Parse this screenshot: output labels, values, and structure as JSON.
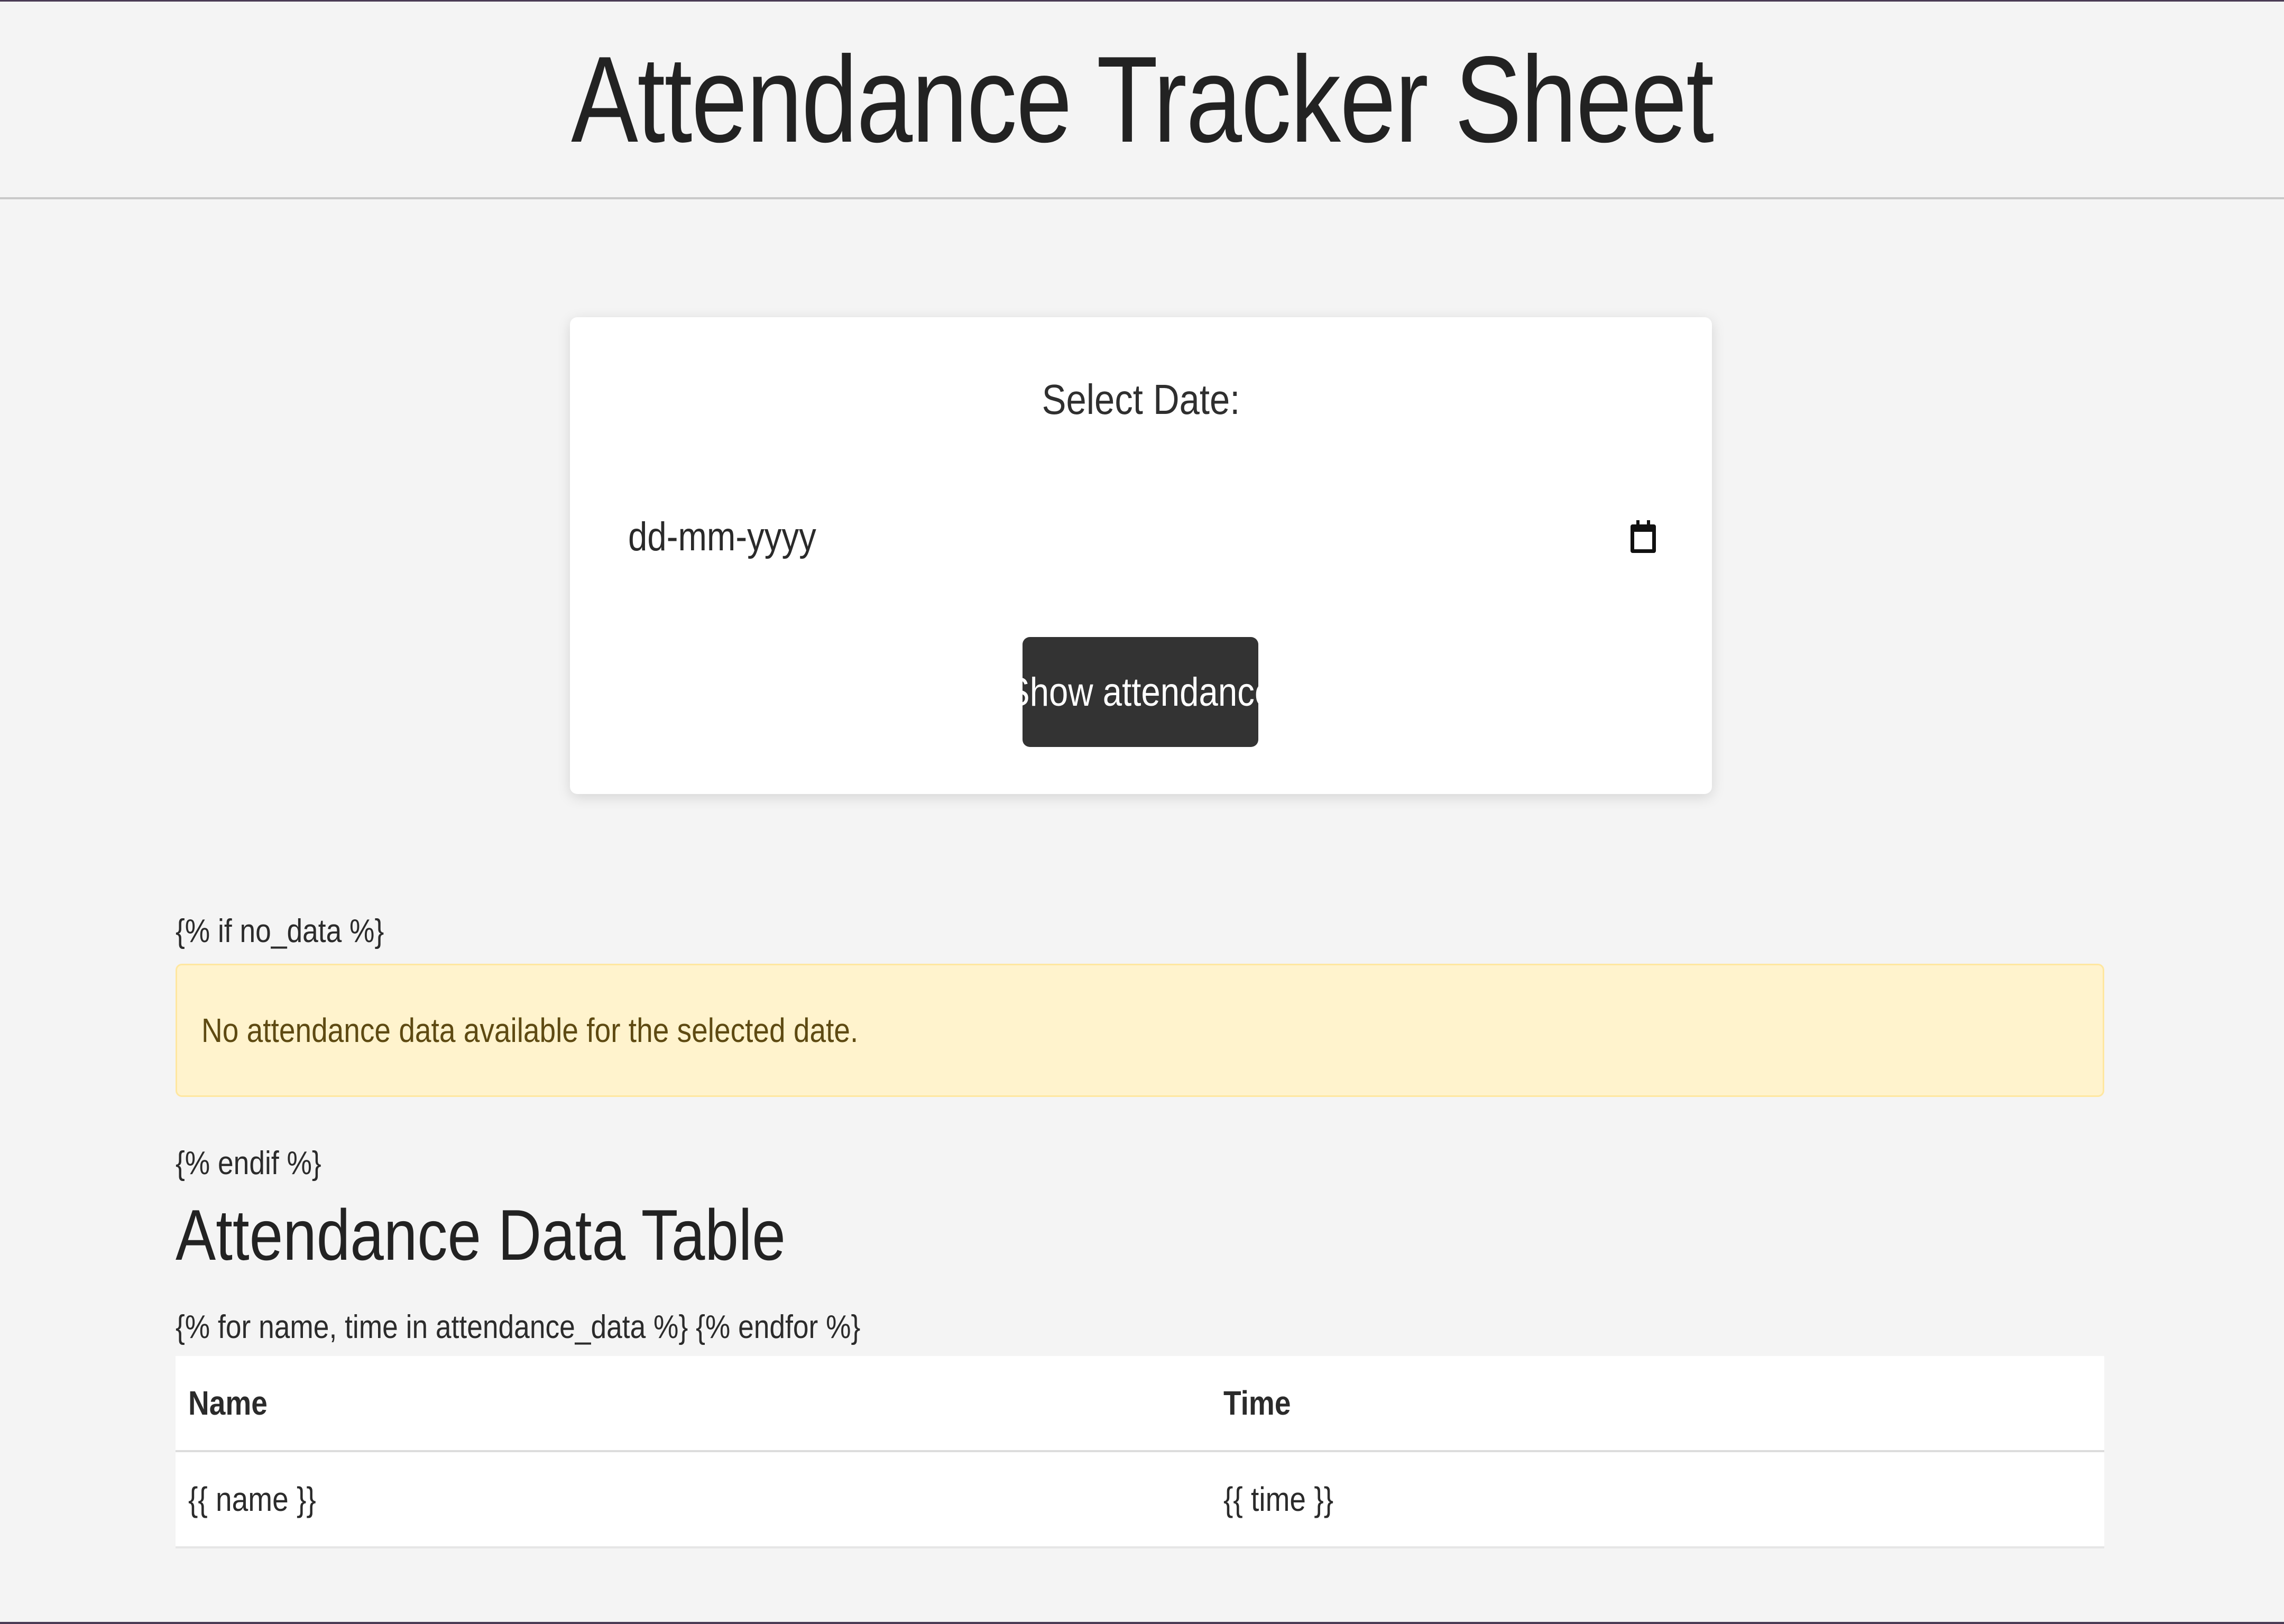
{
  "header": {
    "title": "Attendance Tracker Sheet"
  },
  "form": {
    "label": "Select Date:",
    "date_placeholder": "dd-mm-yyyy",
    "calendar_icon": "calendar-icon",
    "submit_label": "Show attendance"
  },
  "template_lines": {
    "if_no_data": "{% if no_data %}",
    "endif": "{% endif %}",
    "for_loop": "{% for name, time in attendance_data %} {% endfor %}"
  },
  "alert": {
    "message": "No attendance data available for the selected date."
  },
  "table": {
    "title": "Attendance Data Table",
    "headers": [
      "Name",
      "Time"
    ],
    "rows": [
      [
        "{{ name }}",
        "{{ time }}"
      ]
    ]
  },
  "colors": {
    "background": "#f4f4f4",
    "button": "#333333",
    "alert_bg": "#fff3cd",
    "alert_text": "#5e4a12",
    "accent_border": "#4a3b55"
  }
}
